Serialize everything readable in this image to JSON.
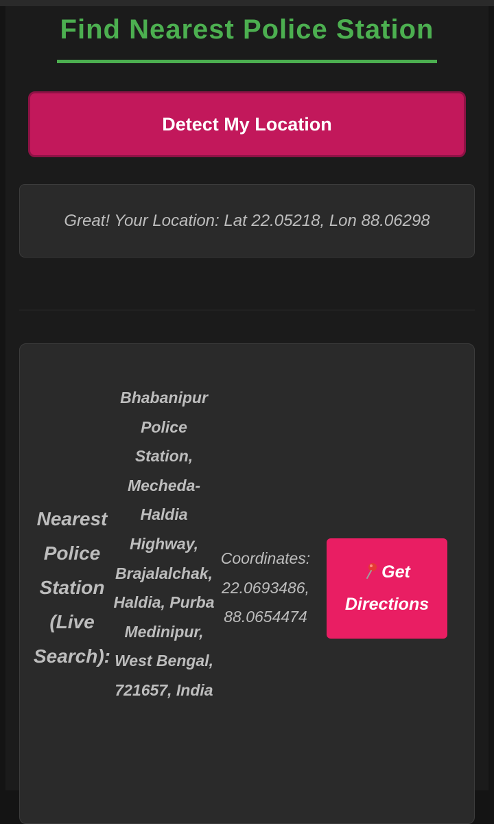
{
  "header": {
    "title": "Find Nearest Police Station"
  },
  "detect": {
    "button_label": "Detect My Location"
  },
  "status": {
    "message": "Great! Your Location: Lat 22.05218, Lon 88.06298"
  },
  "result": {
    "label": "Nearest Police Station (Live Search):",
    "address": "Bhabanipur Police Station, Mecheda-Haldia Highway, Brajalalchak, Haldia, Purba Medinipur, West Bengal, 721657, India",
    "coords": "Coordinates: 22.0693486, 88.0654474",
    "directions_label": "Get Directions",
    "directions_icon": "map-pin-icon"
  },
  "colors": {
    "background": "#1b1b1b",
    "title_green": "#4caf50",
    "detect_button": "#c2185b",
    "directions_button": "#e91e63",
    "card": "#2a2a2a",
    "text_muted": "#bdbdbd"
  }
}
